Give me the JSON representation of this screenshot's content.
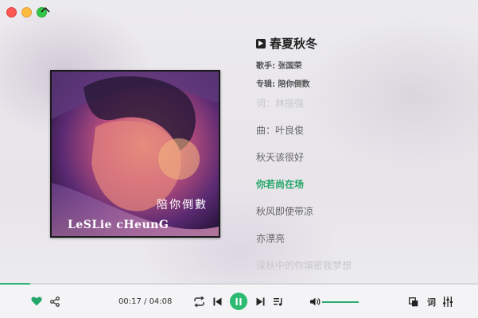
{
  "song": {
    "title": "春夏秋冬",
    "singer_label": "歌手: 张国荣",
    "album_label": "专辑: 陪你倒数"
  },
  "cover": {
    "cjk_text": "陪你倒數",
    "artist_text": "LeSLie cHeunG"
  },
  "lyrics": [
    {
      "text": "词：林振强",
      "state": "faint"
    },
    {
      "text": "曲：叶良俊",
      "state": "normal"
    },
    {
      "text": "秋天该很好",
      "state": "normal"
    },
    {
      "text": "你若尚在场",
      "state": "active"
    },
    {
      "text": "秋风即使带凉",
      "state": "normal"
    },
    {
      "text": "亦漂亮",
      "state": "normal"
    },
    {
      "text": "深秋中的你填密我梦想",
      "state": "faint"
    }
  ],
  "player": {
    "time_display": "00:17 / 04:08",
    "progress_fraction": 0.063,
    "volume_fraction": 1.0,
    "lyric_button_label": "词",
    "liked": true
  },
  "colors": {
    "accent": "#2dbb73",
    "active_lyric": "#25a769"
  },
  "icons": [
    "close-dot",
    "minimize-dot",
    "zoom-dot",
    "chevron-up-icon",
    "play-square-icon",
    "heart-icon",
    "share-icon",
    "repeat-icon",
    "previous-icon",
    "pause-icon",
    "next-icon",
    "playlist-icon",
    "volume-icon",
    "mini-player-icon",
    "lyrics-button",
    "equalizer-icon"
  ]
}
